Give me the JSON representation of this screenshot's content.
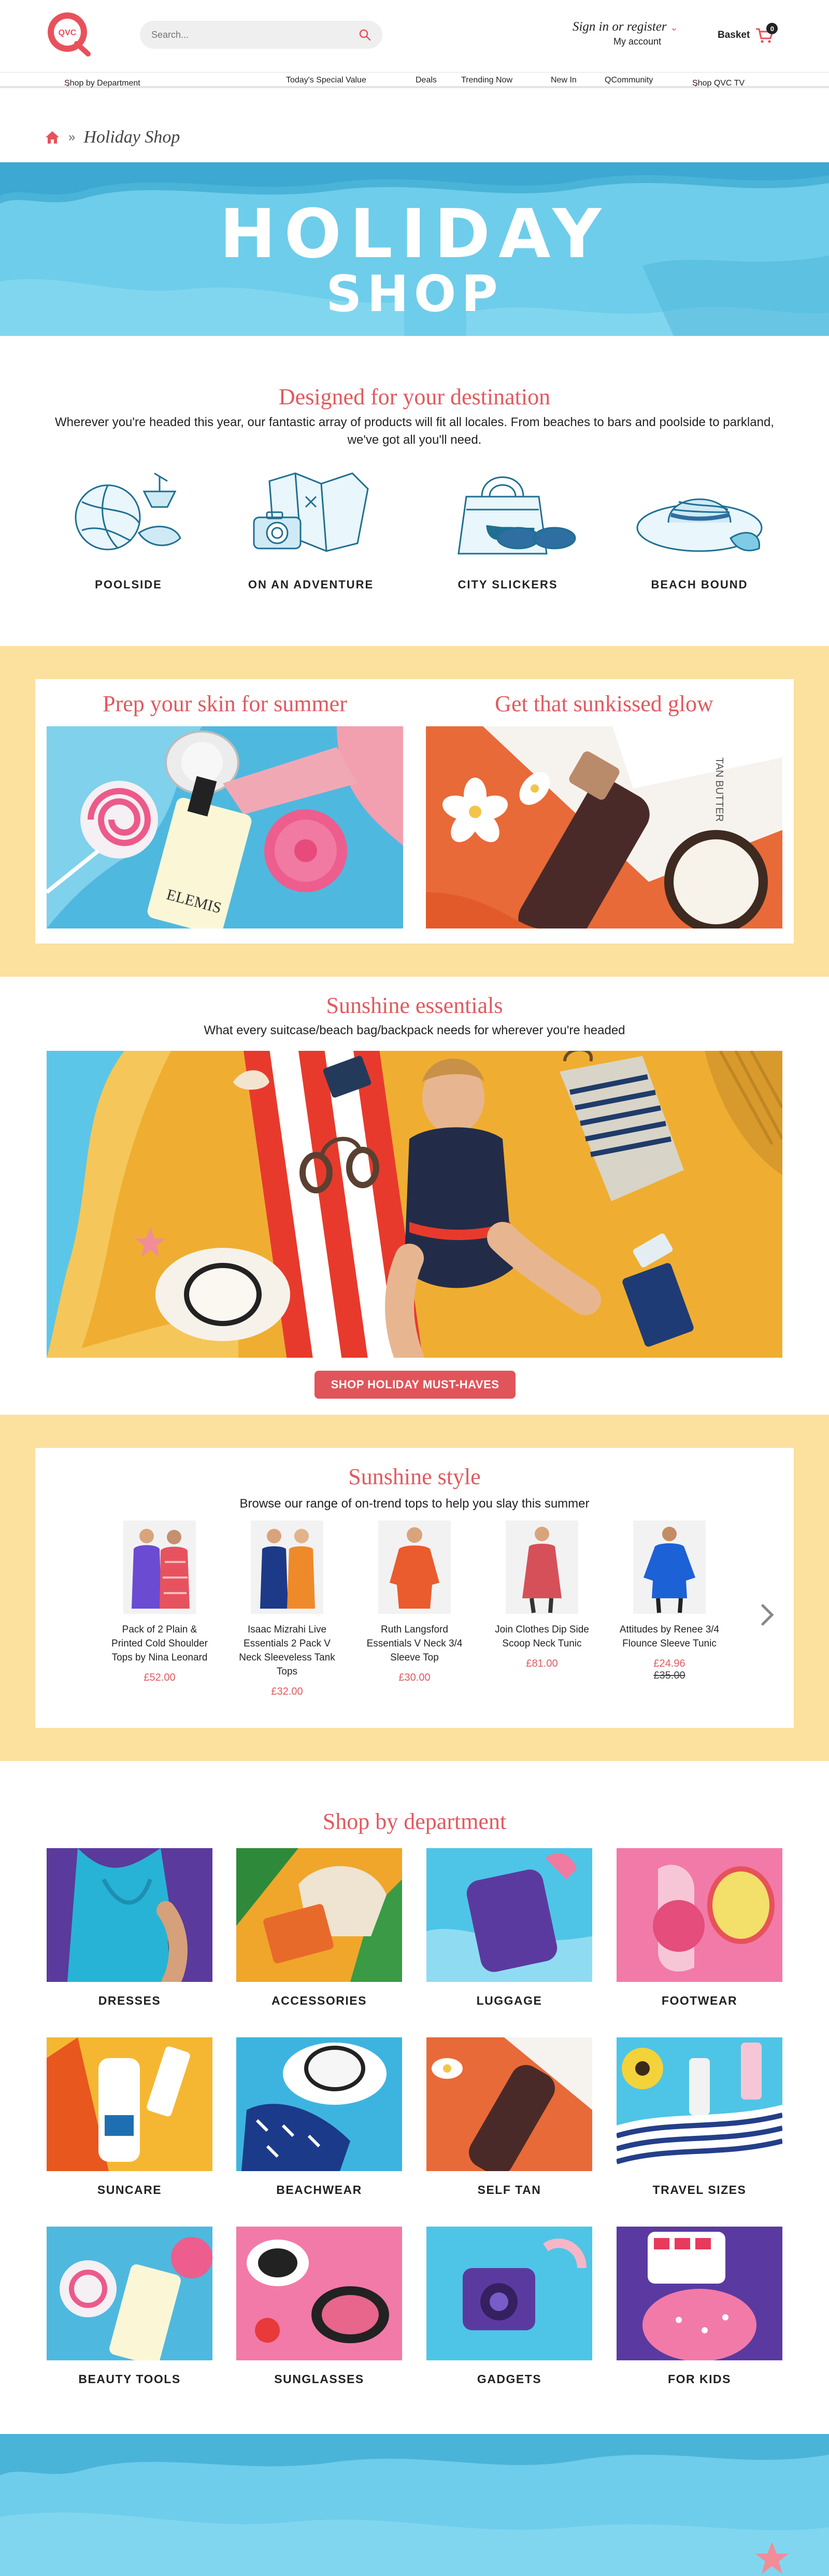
{
  "header": {
    "logo_text": "QVC",
    "search_placeholder": "Search...",
    "signin_label": "Sign in or register",
    "account_label": "My account",
    "basket_label": "Basket",
    "basket_count": "0"
  },
  "nav": {
    "items": [
      "Shop by Department",
      "Today's Special Value",
      "Deals",
      "Trending Now",
      "New In",
      "QCommunity",
      "Shop QVC TV"
    ]
  },
  "breadcrumb": {
    "title": "Holiday Shop"
  },
  "hero": {
    "line1": "HOLIDAY",
    "line2": "SHOP"
  },
  "destination": {
    "title": "Designed for your destination",
    "text": "Wherever you're headed this year, our fantastic array of products will fit all locales. From beaches to bars and poolside to parkland, we've got all you'll need.",
    "items": [
      "POOLSIDE",
      "ON AN ADVENTURE",
      "CITY SLICKERS",
      "BEACH BOUND"
    ]
  },
  "promo": {
    "left_title": "Prep your skin for summer",
    "left_brand": "ELEMIS",
    "right_title": "Get that sunkissed glow",
    "right_brand": "TAN BUTTER"
  },
  "essentials": {
    "title": "Sunshine essentials",
    "subtitle": "What every suitcase/beach bag/backpack needs for wherever you're headed",
    "button": "SHOP HOLIDAY MUST-HAVES"
  },
  "style": {
    "title": "Sunshine style",
    "subtitle": "Browse our range of on-trend tops to help you slay this summer",
    "products": [
      {
        "name": "Pack of 2 Plain & Printed Cold Shoulder Tops by Nina Leonard",
        "price": "£52.00",
        "was": ""
      },
      {
        "name": "Isaac Mizrahi Live Essentials 2 Pack V Neck Sleeveless Tank Tops",
        "price": "£32.00",
        "was": ""
      },
      {
        "name": "Ruth Langsford Essentials V Neck 3/4 Sleeve Top",
        "price": "£30.00",
        "was": ""
      },
      {
        "name": "Join Clothes Dip Side Scoop Neck Tunic",
        "price": "£81.00",
        "was": ""
      },
      {
        "name": "Attitudes by Renee 3/4 Flounce Sleeve Tunic",
        "price": "£24.96",
        "was": "£35.00"
      }
    ]
  },
  "departments": {
    "title": "Shop by department",
    "items": [
      "DRESSES",
      "ACCESSORIES",
      "LUGGAGE",
      "FOOTWEAR",
      "SUNCARE",
      "BEACHWEAR",
      "SELF TAN",
      "TRAVEL SIZES",
      "BEAUTY TOOLS",
      "SUNGLASSES",
      "GADGETS",
      "FOR KIDS"
    ]
  },
  "colors": {
    "accent": "#e05a5f",
    "sky": "#6ecdea",
    "sand": "#fce09e",
    "illustration": "#1f6f93"
  }
}
